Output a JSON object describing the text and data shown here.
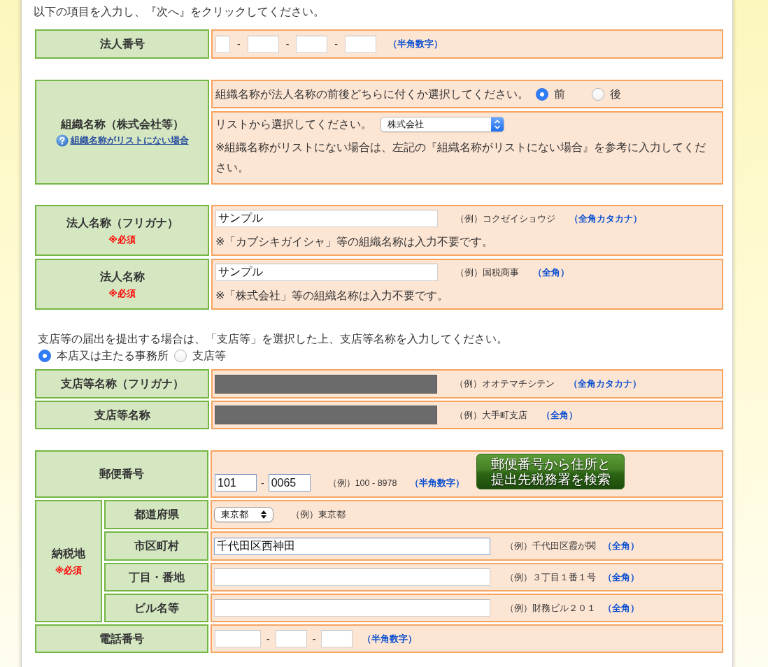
{
  "instruction": "以下の項目を入力し、『次へ』をクリックしてください。",
  "corporate_number": {
    "label": "法人番号",
    "fields": [
      {
        "kind": "tiny"
      },
      {
        "kind": "short",
        "separator": "-"
      },
      {
        "kind": "short",
        "separator": "-"
      },
      {
        "kind": "short",
        "separator": "-"
      }
    ],
    "format_hint": "（半角数字）"
  },
  "organization": {
    "label": "組織名称（株式会社等）",
    "help_link": "組織名称がリストにない場合",
    "position_question": "組織名称が法人名称の前後どちらに付くか選択してください。",
    "position_options": [
      {
        "label": "前",
        "selected": true
      },
      {
        "label": "後",
        "selected": false
      }
    ],
    "list_prompt": "リストから選択してください。",
    "select": {
      "value": "株式会社",
      "focused": true
    },
    "note": "※組織名称がリストにない場合は、左記の『組織名称がリストにない場合』を参考に入力してください。"
  },
  "corporate_names": [
    {
      "label": "法人名称（フリガナ）",
      "required": "※必須",
      "field": {
        "kind": "wide",
        "value": "サンプル"
      },
      "example": "（例）コクゼイショウジ",
      "format_hint": "（全角カタカナ）",
      "note": "※「カブシキガイシャ」等の組織名称は入力不要です。"
    },
    {
      "label": "法人名称",
      "required": "※必須",
      "field": {
        "kind": "wide",
        "value": "サンプル"
      },
      "example": "（例）国税商事",
      "format_hint": "（全角）",
      "note": "※「株式会社」等の組織名称は入力不要です。"
    }
  ],
  "branch": {
    "instruction": "支店等の届出を提出する場合は、「支店等」を選択した上、支店等名称を入力してください。",
    "options": [
      {
        "label": "本店又は主たる事務所",
        "selected": true
      },
      {
        "label": "支店等",
        "selected": false
      }
    ],
    "rows": [
      {
        "label": "支店等名称（フリガナ）",
        "field": {
          "kind": "wide",
          "disabled": true
        },
        "example": "（例）オオテマチシテン",
        "format_hint": "（全角カタカナ）"
      },
      {
        "label": "支店等名称",
        "field": {
          "kind": "wide",
          "disabled": true
        },
        "example": "（例）大手町支店",
        "format_hint": "（全角）"
      }
    ]
  },
  "postal_code": {
    "label": "郵便番号",
    "fields": [
      {
        "kind": "medium",
        "value": "101",
        "highlighted": true
      },
      {
        "kind": "medium",
        "separator": "-",
        "value": "0065",
        "highlighted": true
      }
    ],
    "example": "（例）100 - 8978",
    "format_hint": "（半角数字）",
    "search_button": "郵便番号から住所と提出先税務署を検索"
  },
  "tax_address": {
    "label": "納税地",
    "required": "※必須",
    "rows": [
      {
        "kind": "select",
        "label": "都道府県",
        "select": {
          "value": "東京都",
          "focused": false
        },
        "example": "（例）東京都"
      },
      {
        "kind": "input",
        "label": "市区町村",
        "field": {
          "kind": "long",
          "value": "千代田区西神田",
          "highlighted": true
        },
        "example": "（例）千代田区霞が関",
        "format_hint": "（全角）"
      },
      {
        "kind": "input",
        "label": "丁目・番地",
        "field": {
          "kind": "long",
          "highlighted": false
        },
        "example": "（例）３丁目１番１号",
        "format_hint": "（全角）"
      },
      {
        "kind": "input",
        "label": "ビル名等",
        "field": {
          "kind": "long",
          "highlighted": false
        },
        "example": "（例）財務ビル２０１",
        "format_hint": "（全角）"
      }
    ]
  },
  "phone": {
    "label": "電話番号",
    "fields": [
      {
        "kind": "phone"
      },
      {
        "kind": "short",
        "separator": "-"
      },
      {
        "kind": "short",
        "separator": "-"
      }
    ],
    "format_hint": "（半角数字）"
  }
}
